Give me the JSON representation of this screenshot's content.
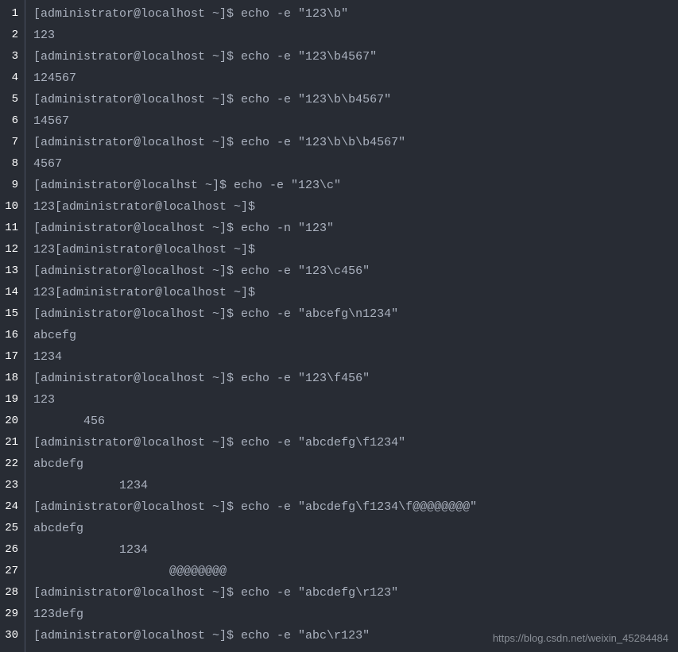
{
  "lines": [
    "[administrator@localhost ~]$ echo -e \"123\\b\"",
    "123",
    "[administrator@localhost ~]$ echo -e \"123\\b4567\"",
    "124567",
    "[administrator@localhost ~]$ echo -e \"123\\b\\b4567\"",
    "14567",
    "[administrator@localhost ~]$ echo -e \"123\\b\\b\\b4567\"",
    "4567",
    "[administrator@localhst ~]$ echo -e \"123\\c\"",
    "123[administrator@localhost ~]$",
    "[administrator@localhost ~]$ echo -n \"123\"",
    "123[administrator@localhost ~]$",
    "[administrator@localhost ~]$ echo -e \"123\\c456\"",
    "123[administrator@localhost ~]$",
    "[administrator@localhost ~]$ echo -e \"abcefg\\n1234\"",
    "abcefg",
    "1234",
    "[administrator@localhost ~]$ echo -e \"123\\f456\"",
    "123",
    "       456",
    "[administrator@localhost ~]$ echo -e \"abcdefg\\f1234\"",
    "abcdefg",
    "            1234",
    "[administrator@localhost ~]$ echo -e \"abcdefg\\f1234\\f@@@@@@@@\"",
    "abcdefg",
    "            1234",
    "                   @@@@@@@@",
    "[administrator@localhost ~]$ echo -e \"abcdefg\\r123\"",
    "123defg",
    "[administrator@localhost ~]$ echo -e \"abc\\r123\""
  ],
  "watermark": "https://blog.csdn.net/weixin_45284484"
}
